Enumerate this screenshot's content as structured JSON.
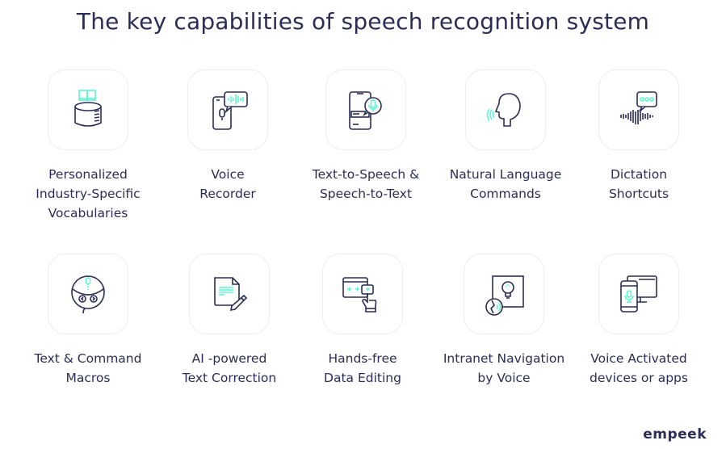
{
  "title": "The key capabilities of speech recognition system",
  "colors": {
    "primary": "#2b2d55",
    "accent": "#5ef5d2",
    "tile_border": "#ececf1"
  },
  "capabilities": [
    {
      "label": "Personalized\nIndustry-Specific\nVocabularies",
      "icon": "book-database-icon"
    },
    {
      "label": "Voice\nRecorder",
      "icon": "phone-voice-recorder-icon"
    },
    {
      "label": "Text-to-Speech &\nSpeech-to-Text",
      "icon": "phone-mic-text-icon"
    },
    {
      "label": "Natural Language\nCommands",
      "icon": "speaking-head-icon"
    },
    {
      "label": "Dictation\nShortcuts",
      "icon": "soundwave-chat-icon"
    },
    {
      "label": "Text & Command\nMacros",
      "icon": "voice-remote-icon"
    },
    {
      "label": "AI -powered\nText Correction",
      "icon": "document-pencil-icon"
    },
    {
      "label": "Hands-free\nData Editing",
      "icon": "window-hand-tap-icon"
    },
    {
      "label": "Intranet Navigation\nby Voice",
      "icon": "lightbulb-switch-voice-icon"
    },
    {
      "label": "Voice Activated\ndevices or apps",
      "icon": "phone-monitor-mic-icon"
    }
  ],
  "brand": "empeek"
}
